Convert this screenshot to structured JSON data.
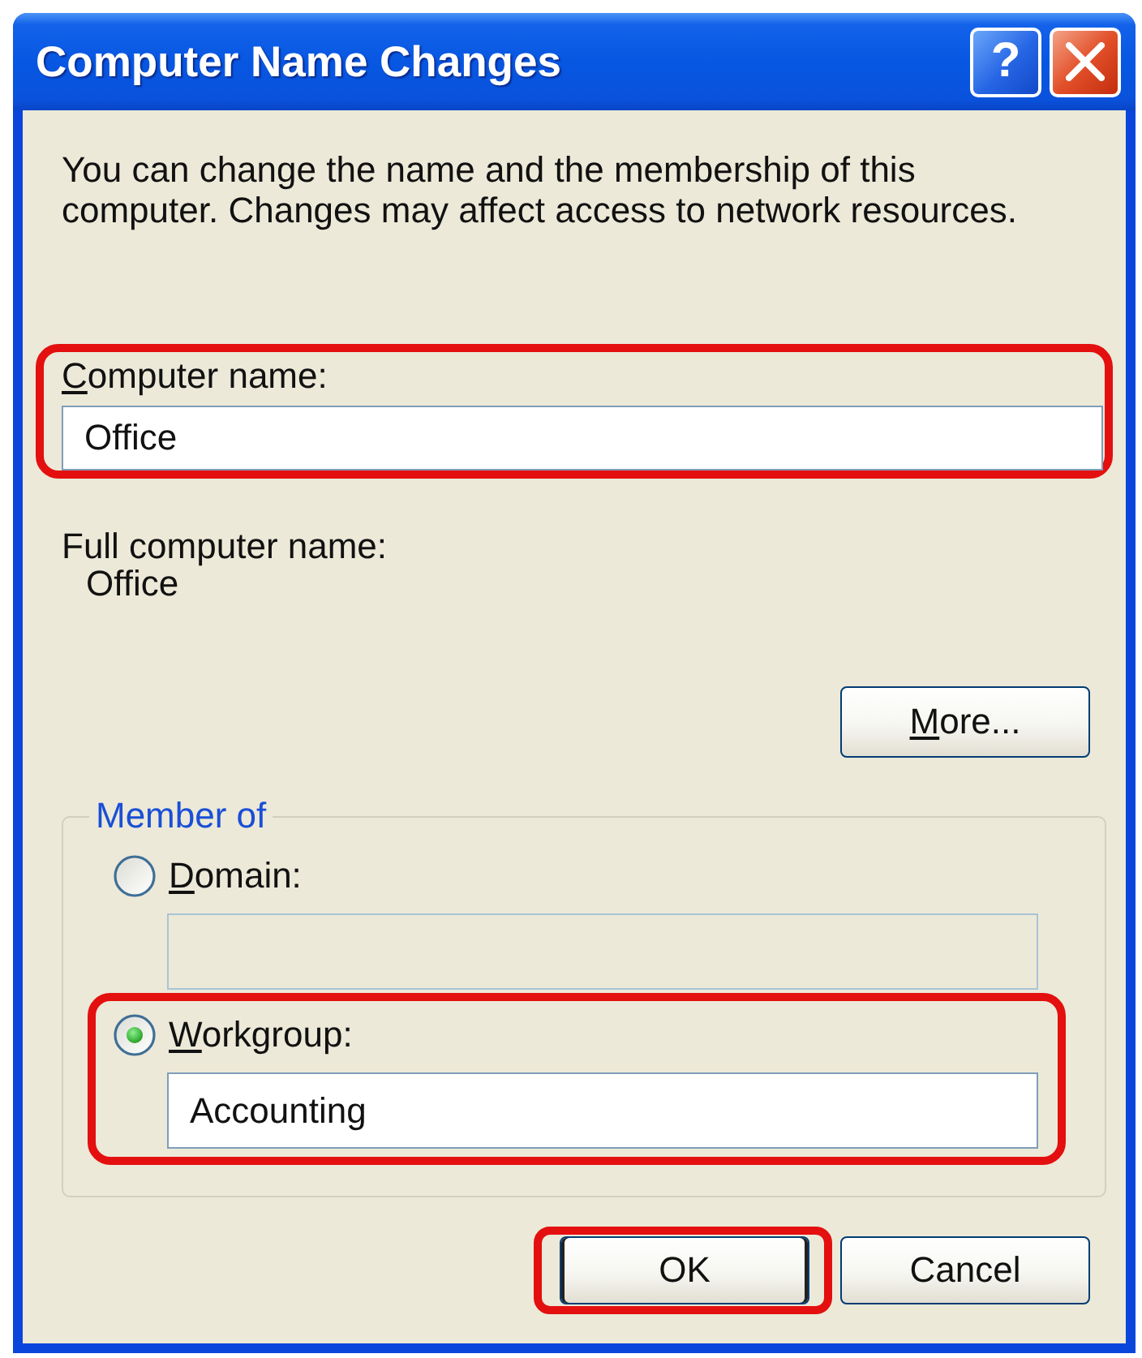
{
  "window": {
    "title": "Computer Name Changes",
    "help_button": "?"
  },
  "description": "You can change the name and the membership of this computer. Changes may affect access to network resources.",
  "computer_name": {
    "label_key": "C",
    "label_rest": "omputer name:",
    "value": "Office",
    "highlighted": true
  },
  "full_computer_name": {
    "label": "Full computer name:",
    "value": "Office"
  },
  "more_button": {
    "label_key": "M",
    "label_rest": "ore..."
  },
  "member_of": {
    "title": "Member of",
    "options": [
      {
        "label_key": "D",
        "label_rest": "omain:",
        "selected": false,
        "disabled": true,
        "highlighted": false
      },
      {
        "label_key": "W",
        "label_rest": "orkgroup:",
        "selected": true,
        "disabled": false,
        "value": "Accounting",
        "highlighted": true
      }
    ]
  },
  "buttons": [
    {
      "label": "OK",
      "default": true,
      "highlighted": true
    },
    {
      "label": "Cancel",
      "default": false,
      "highlighted": false
    }
  ]
}
